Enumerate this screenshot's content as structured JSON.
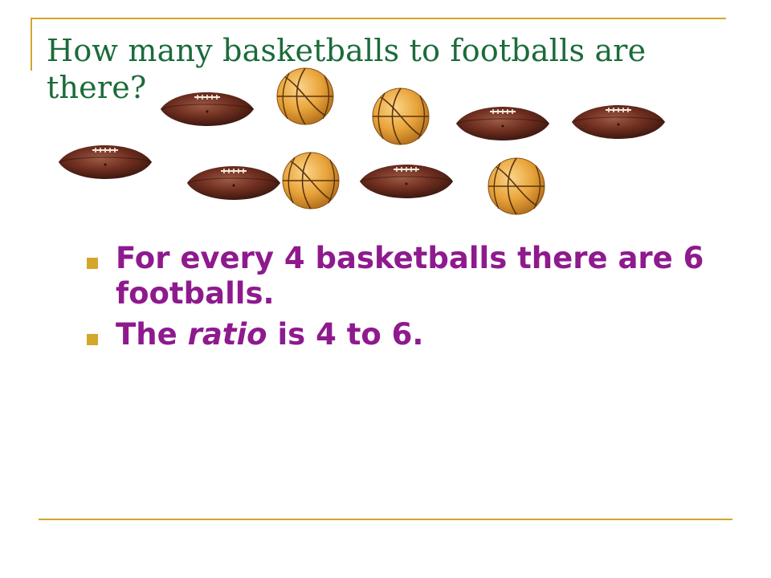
{
  "slide": {
    "title": "How many basketballs to footballs are there?",
    "bullets": [
      {
        "text": "For every 4 basketballs there are 6 footballs."
      },
      {
        "before": "The",
        "emphasis": "ratio",
        "after": "is 4 to 6."
      }
    ],
    "counts": {
      "basketballs": 4,
      "footballs": 6
    },
    "colors": {
      "title": "#1b6b3a",
      "bullet_text": "#8e1a8e",
      "accent": "#d4a62a",
      "football": "#6e2e1f",
      "basketball": "#e8a43a"
    }
  }
}
